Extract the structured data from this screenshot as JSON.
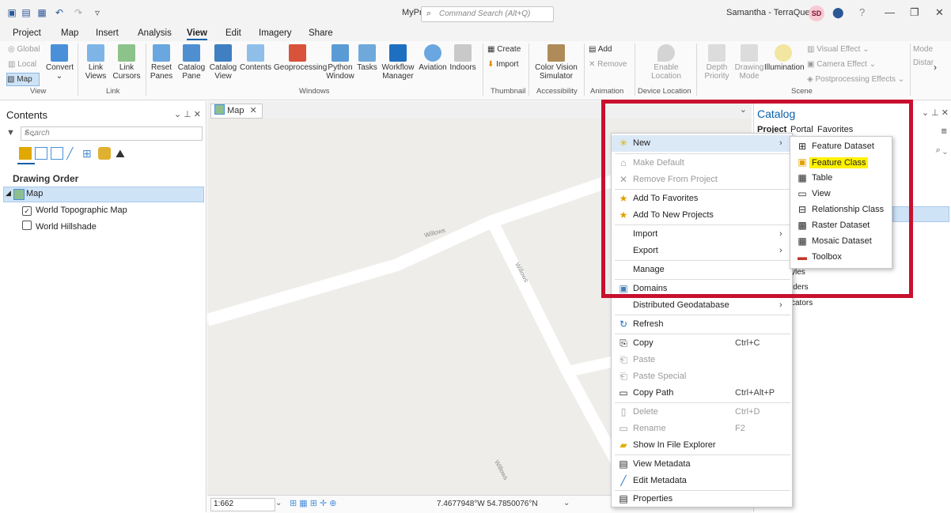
{
  "titlebar": {
    "app_title": "MyProject",
    "search_placeholder": "Command Search (Alt+Q)",
    "user_name": "Samantha - TerraQuest",
    "avatar_initials": "SD"
  },
  "tabs": [
    "Project",
    "Map",
    "Insert",
    "Analysis",
    "View",
    "Edit",
    "Imagery",
    "Share"
  ],
  "ribbon": {
    "view_group": {
      "global": "Global",
      "local": "Local",
      "map": "Map",
      "convert": "Convert"
    },
    "link_group": {
      "link_views": "Link Views",
      "link_cursors": "Link Cursors"
    },
    "windows_group": [
      "Reset Panes",
      "Catalog Pane",
      "Catalog View",
      "Contents",
      "Geoprocessing",
      "Python Window",
      "Tasks",
      "Workflow Manager",
      "Aviation",
      "Indoors"
    ],
    "thumbnail_group": {
      "create": "Create",
      "import": "Import"
    },
    "accessibility_group": {
      "color_vision": "Color Vision Simulator"
    },
    "animation_group": {
      "add": "Add",
      "remove": "Remove"
    },
    "device_location_group": {
      "enable": "Enable Location"
    },
    "scene_group": {
      "depth_priority": "Depth Priority",
      "drawing_mode": "Drawing Mode",
      "illumination": "Illumination",
      "visual_effect": "Visual Effect",
      "camera_effect": "Camera Effect",
      "postprocessing": "Postprocessing Effects"
    },
    "right_group": {
      "mode": "Mode",
      "distance": "Distar"
    },
    "group_labels": [
      "View",
      "Link",
      "Windows",
      "Thumbnail",
      "Accessibility",
      "Animation",
      "Device Location",
      "Scene"
    ]
  },
  "contents": {
    "title": "Contents",
    "search_placeholder": "Search",
    "drawing_order": "Drawing Order",
    "map_label": "Map",
    "layers": [
      {
        "name": "World Topographic Map",
        "checked": true
      },
      {
        "name": "World Hillshade",
        "checked": false
      }
    ]
  },
  "map": {
    "tab_label": "Map",
    "road_labels": [
      "Willows",
      "Willows",
      "Willows"
    ],
    "scale": "1:662",
    "coordinates": "7.4677948°W 54.7850076°N"
  },
  "catalog": {
    "title": "Catalog",
    "tabs": [
      "Project",
      "Portal",
      "Favorites"
    ],
    "visible_items": [
      "yles",
      "lders",
      "cators"
    ]
  },
  "context_menu": {
    "items": [
      {
        "label": "New",
        "icon": "new-star-icon",
        "submenu": true
      },
      {
        "label": "Make Default",
        "icon": "home-icon",
        "disabled": true
      },
      {
        "label": "Remove From Project",
        "icon": "x-icon",
        "disabled": true
      },
      {
        "label": "Add To Favorites",
        "icon": "star-icon"
      },
      {
        "label": "Add To New Projects",
        "icon": "star-plus-icon"
      },
      {
        "label": "Import",
        "submenu": true
      },
      {
        "label": "Export",
        "submenu": true
      },
      {
        "label": "Manage"
      },
      {
        "label": "Domains",
        "icon": "domains-icon"
      },
      {
        "label": "Distributed Geodatabase",
        "submenu": true
      },
      {
        "label": "Refresh",
        "icon": "refresh-icon"
      },
      {
        "label": "Copy",
        "icon": "copy-icon",
        "shortcut": "Ctrl+C"
      },
      {
        "label": "Paste",
        "icon": "paste-icon",
        "disabled": true
      },
      {
        "label": "Paste Special",
        "icon": "paste-special-icon",
        "disabled": true
      },
      {
        "label": "Copy Path",
        "icon": "copy-path-icon",
        "shortcut": "Ctrl+Alt+P"
      },
      {
        "label": "Delete",
        "icon": "delete-icon",
        "shortcut": "Ctrl+D",
        "disabled": true
      },
      {
        "label": "Rename",
        "icon": "rename-icon",
        "shortcut": "F2",
        "disabled": true
      },
      {
        "label": "Show In File Explorer",
        "icon": "folder-icon"
      },
      {
        "label": "View Metadata",
        "icon": "metadata-icon"
      },
      {
        "label": "Edit Metadata",
        "icon": "pencil-icon"
      },
      {
        "label": "Properties",
        "icon": "properties-icon"
      }
    ]
  },
  "submenu": {
    "items": [
      {
        "label": "Feature Dataset"
      },
      {
        "label": "Feature Class",
        "highlighted": true
      },
      {
        "label": "Table"
      },
      {
        "label": "View"
      },
      {
        "label": "Relationship Class"
      },
      {
        "label": "Raster Dataset"
      },
      {
        "label": "Mosaic Dataset"
      },
      {
        "label": "Toolbox"
      }
    ],
    "highlight_color": "#fff200"
  },
  "colors": {
    "accent": "#0a5fa8",
    "annotation_box": "#c8102e",
    "menu_hover": "#dbe9f7"
  }
}
